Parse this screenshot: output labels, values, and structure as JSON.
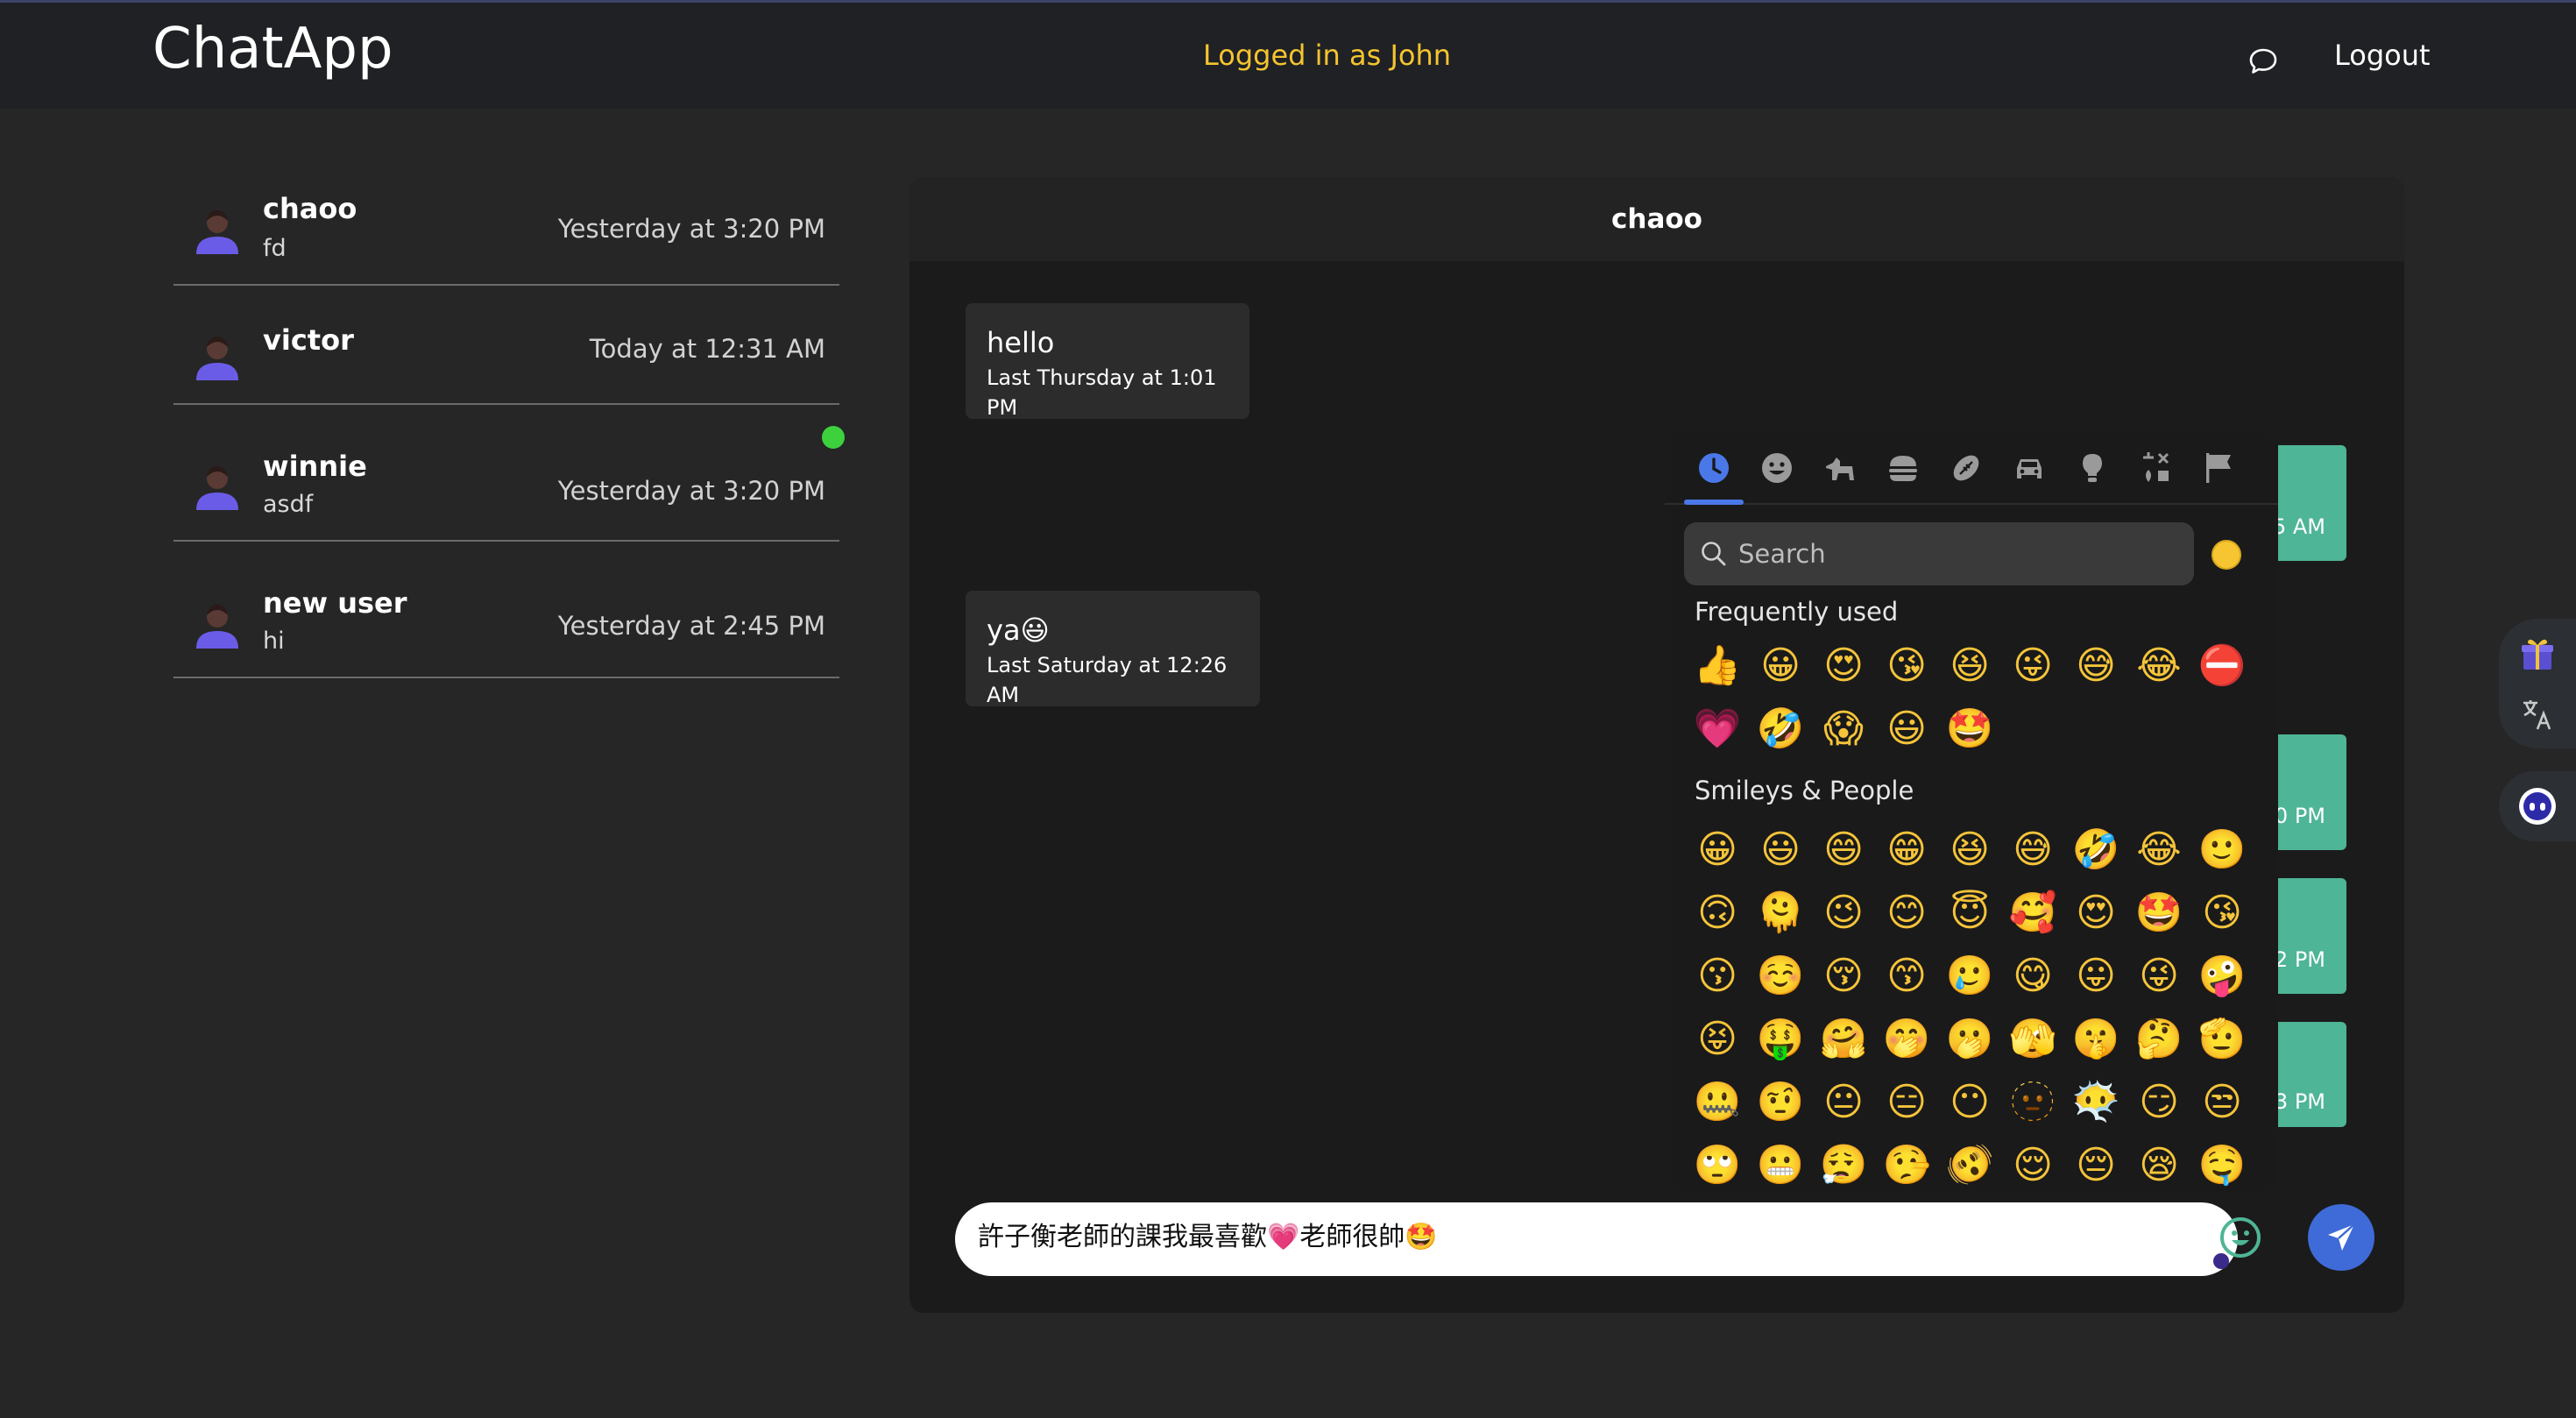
{
  "app": {
    "brand": "ChatApp",
    "logged_in_text": "Logged in as John",
    "logout_label": "Logout"
  },
  "contacts": [
    {
      "name": "chaoo",
      "preview": "fd",
      "time": "Yesterday at 3:20 PM"
    },
    {
      "name": "victor",
      "preview": "",
      "time": "Today at 12:31 AM"
    },
    {
      "name": "winnie",
      "preview": "asdf",
      "time": "Yesterday at 3:20 PM",
      "online": true
    },
    {
      "name": "new user",
      "preview": "hi",
      "time": "Yesterday at 2:45 PM"
    }
  ],
  "chat": {
    "title": "chaoo",
    "messages_in": [
      {
        "text": "hello",
        "time": "Last Thursday at 1:01 PM"
      },
      {
        "text": "ya😃",
        "time": "Last Saturday at 12:26 AM"
      }
    ],
    "messages_out_time_fragments": [
      "5 AM",
      "0 PM",
      "2 PM",
      "3 PM"
    ],
    "input_value": "許子衡老師的課我最喜歡💗老師很帥🤩"
  },
  "emoji_picker": {
    "search_placeholder": "Search",
    "categories": [
      "recent-icon",
      "smiley-icon",
      "animal-icon",
      "food-icon",
      "activity-icon",
      "travel-icon",
      "objects-icon",
      "symbols-icon",
      "flag-icon"
    ],
    "frequently_used_label": "Frequently used",
    "frequently_used": [
      "👍",
      "😀",
      "😍",
      "😘",
      "😆",
      "😜",
      "😅",
      "😂",
      "⛔",
      "💗",
      "🤣",
      "😱",
      "😃",
      "🤩"
    ],
    "smileys_label": "Smileys & People",
    "smileys": [
      "😀",
      "😃",
      "😄",
      "😁",
      "😆",
      "😅",
      "🤣",
      "😂",
      "🙂",
      "🙃",
      "🫠",
      "😉",
      "😊",
      "😇",
      "🥰",
      "😍",
      "🤩",
      "😘",
      "😗",
      "☺️",
      "😚",
      "😙",
      "🥲",
      "😋",
      "😛",
      "😜",
      "🤪",
      "😝",
      "🤑",
      "🤗",
      "🤭",
      "🫢",
      "🫣",
      "🤫",
      "🤔",
      "🫡",
      "🤐",
      "🤨",
      "😐",
      "😑",
      "😶",
      "🫥",
      "😶‍🌫️",
      "😏",
      "😒",
      "🙄",
      "😬",
      "😮‍💨",
      "🤥",
      "🫨",
      "😌",
      "😔",
      "😪",
      "🤤"
    ]
  },
  "colors": {
    "accent_green": "#4eb596",
    "send_blue": "#3f6bd8",
    "logged_in_yellow": "#f4c430",
    "online_green": "#3ed13e"
  }
}
